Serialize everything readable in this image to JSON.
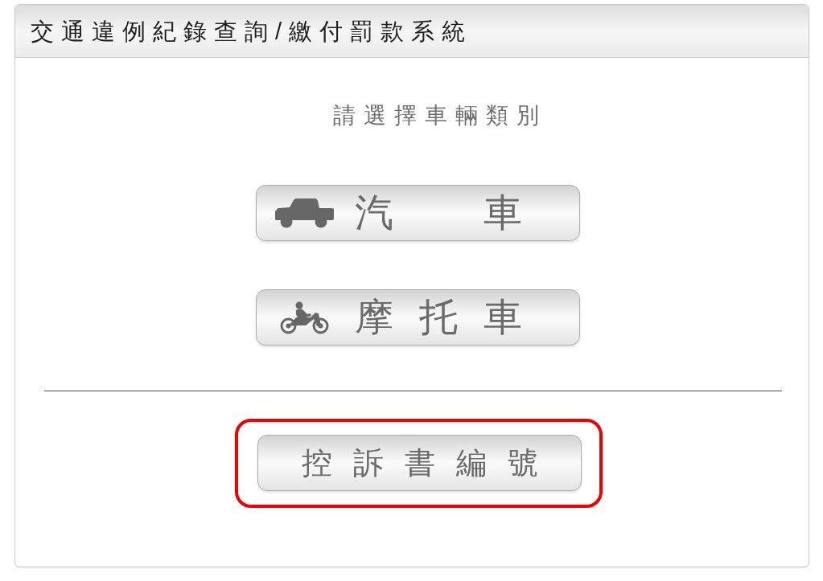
{
  "header": {
    "title": "交通違例紀錄查詢/繳付罰款系統"
  },
  "prompt": "請選擇車輛類別",
  "vehicle_buttons": [
    {
      "kind": "car",
      "label": "汽　車",
      "highlighted": false
    },
    {
      "kind": "motorcycle",
      "label": "摩托車",
      "highlighted": false
    }
  ],
  "other_buttons": [
    {
      "label": "控訴書編號",
      "highlighted": true
    }
  ]
}
